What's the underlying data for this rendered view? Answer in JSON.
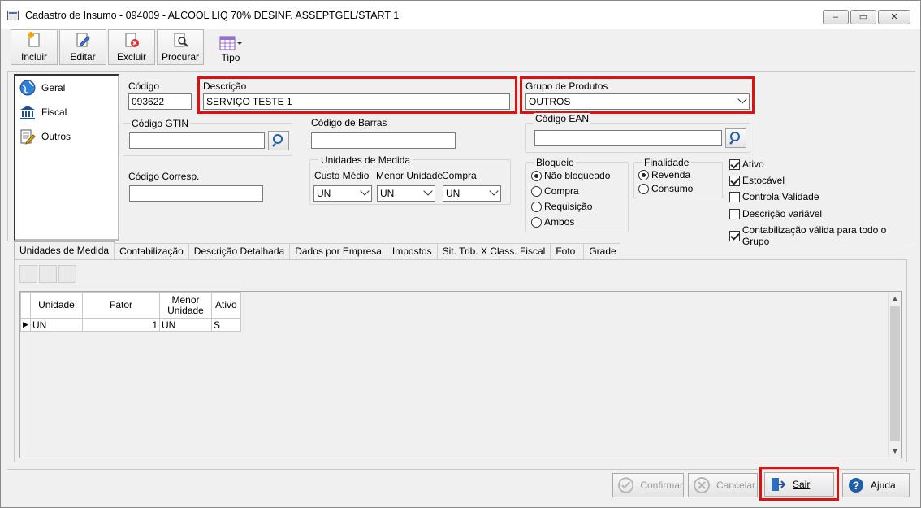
{
  "window": {
    "title": "Cadastro de Insumo - 094009 - ALCOOL LIQ 70% DESINF. ASSEPTGEL/START 1",
    "minimize_glyph": "‒",
    "maximize_glyph": "▭",
    "close_glyph": "✕"
  },
  "toolbar": {
    "incluir": "Incluir",
    "editar": "Editar",
    "excluir": "Excluir",
    "procurar": "Procurar",
    "tipo": "Tipo"
  },
  "nav": {
    "items": [
      {
        "label": "Geral",
        "icon": "globe-icon"
      },
      {
        "label": "Fiscal",
        "icon": "bank-icon"
      },
      {
        "label": "Outros",
        "icon": "document-edit-icon"
      }
    ]
  },
  "form": {
    "codigo_label": "Código",
    "codigo_value": "093622",
    "descricao_label": "Descrição",
    "descricao_value": "SERVIÇO TESTE 1",
    "grupo_label": "Grupo de Produtos",
    "grupo_value": "OUTROS",
    "gtin_label": "Código GTIN",
    "gtin_value": "",
    "barras_label": "Código de Barras",
    "barras_value": "",
    "ean_label": "Código EAN",
    "ean_value": "",
    "corresp_label": "Código Corresp.",
    "corresp_value": "",
    "unidades_group": "Unidades de Medida",
    "custo_medio_label": "Custo Médio",
    "custo_medio_value": "UN",
    "menor_unidade_label": "Menor Unidade",
    "menor_unidade_value": "UN",
    "compra_label": "Compra",
    "compra_value": "UN",
    "bloqueio_group": "Bloqueio",
    "bloqueio_options": [
      "Não bloqueado",
      "Compra",
      "Requisição",
      "Ambos"
    ],
    "bloqueio_selected": "Não bloqueado",
    "finalidade_group": "Finalidade",
    "finalidade_options": [
      "Revenda",
      "Consumo"
    ],
    "finalidade_selected": "Revenda",
    "checks": [
      {
        "label": "Ativo",
        "checked": true
      },
      {
        "label": "Estocável",
        "checked": true
      },
      {
        "label": "Controla Validade",
        "checked": false
      },
      {
        "label": "Descrição variável",
        "checked": false
      },
      {
        "label": "Contabilização válida para todo o Grupo",
        "checked": true
      }
    ]
  },
  "tabs": [
    "Unidades de Medida",
    "Contabilização",
    "Descrição Detalhada",
    "Dados por Empresa",
    "Impostos",
    "Sit. Trib. X Class. Fiscal",
    "Foto",
    "Grade"
  ],
  "active_tab": "Unidades de Medida",
  "grid": {
    "headers": [
      "Unidade",
      "Fator",
      "Menor Unidade",
      "Ativo"
    ],
    "rows": [
      {
        "unidade": "UN",
        "fator": "1",
        "menor": "UN",
        "ativo": "S"
      }
    ]
  },
  "footer": {
    "confirmar": "Confirmar",
    "cancelar": "Cancelar",
    "sair": "Sair",
    "ajuda": "Ajuda"
  },
  "colors": {
    "highlight": "#e01010",
    "accent": "#1f5fa8"
  }
}
